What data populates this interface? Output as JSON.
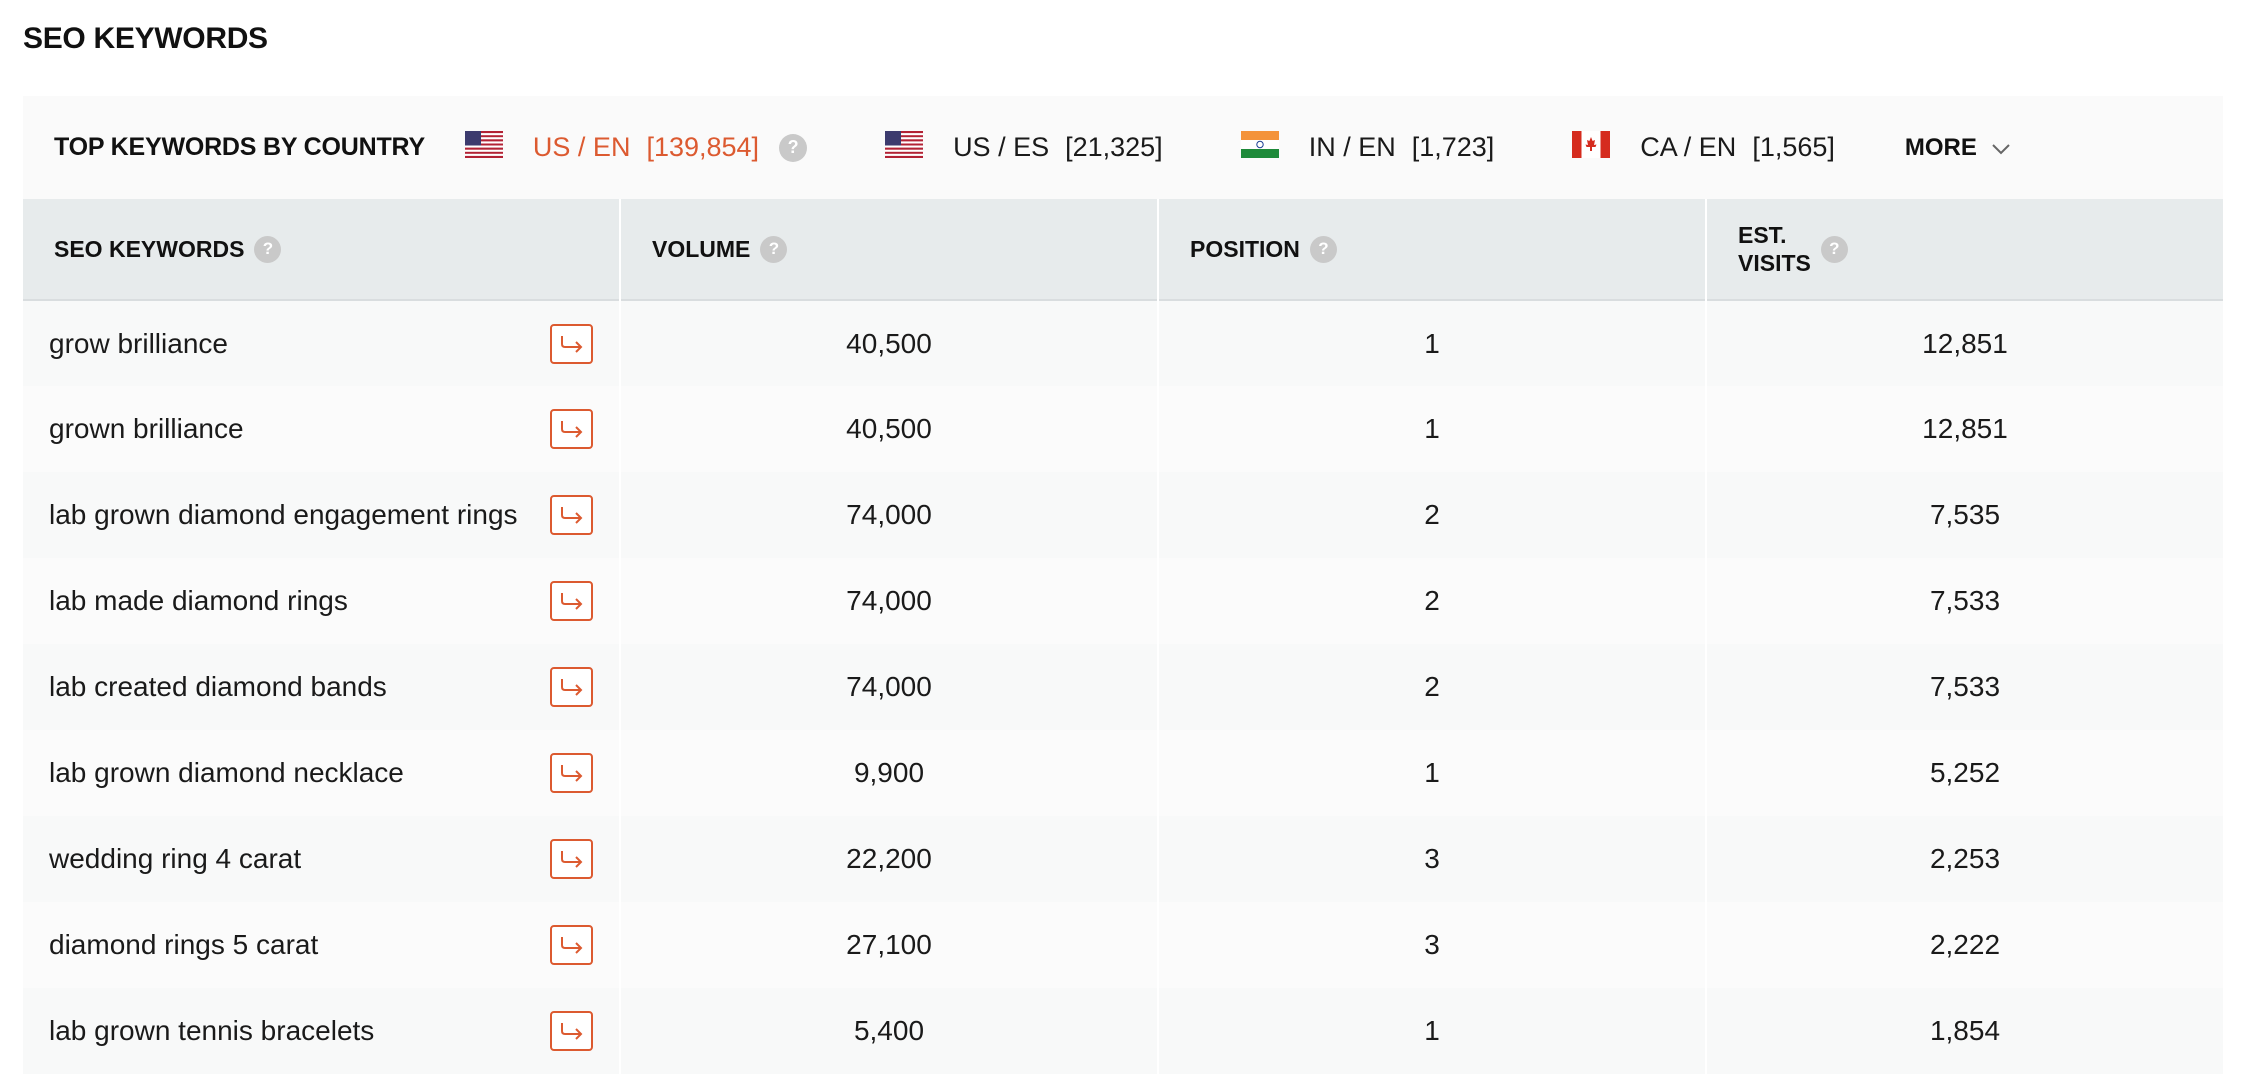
{
  "page": {
    "title": "SEO KEYWORDS"
  },
  "country_bar": {
    "label": "TOP KEYWORDS BY COUNTRY",
    "tabs": [
      {
        "code": "US / EN",
        "count": "[139,854]",
        "flag": "us-flag-icon",
        "active": true
      },
      {
        "code": "US / ES",
        "count": "[21,325]",
        "flag": "us-flag-icon",
        "active": false
      },
      {
        "code": "IN / EN",
        "count": "[1,723]",
        "flag": "india-flag-icon",
        "active": false
      },
      {
        "code": "CA / EN",
        "count": "[1,565]",
        "flag": "canada-flag-icon",
        "active": false
      }
    ],
    "more_label": "MORE",
    "help_glyph": "?"
  },
  "table": {
    "columns": [
      {
        "label": "SEO KEYWORDS"
      },
      {
        "label": "VOLUME"
      },
      {
        "label": "POSITION"
      },
      {
        "label": "EST.\nVISITS"
      }
    ],
    "rows": [
      {
        "keyword": "grow brilliance",
        "volume": "40,500",
        "position": "1",
        "visits": "12,851"
      },
      {
        "keyword": "grown brilliance",
        "volume": "40,500",
        "position": "1",
        "visits": "12,851"
      },
      {
        "keyword": "lab grown diamond engagement rings",
        "volume": "74,000",
        "position": "2",
        "visits": "7,535"
      },
      {
        "keyword": "lab made diamond rings",
        "volume": "74,000",
        "position": "2",
        "visits": "7,533"
      },
      {
        "keyword": "lab created diamond bands",
        "volume": "74,000",
        "position": "2",
        "visits": "7,533"
      },
      {
        "keyword": "lab grown diamond necklace",
        "volume": "9,900",
        "position": "1",
        "visits": "5,252"
      },
      {
        "keyword": "wedding ring 4 carat",
        "volume": "22,200",
        "position": "3",
        "visits": "2,253"
      },
      {
        "keyword": "diamond rings 5 carat",
        "volume": "27,100",
        "position": "3",
        "visits": "2,222"
      },
      {
        "keyword": "lab grown tennis bracelets",
        "volume": "5,400",
        "position": "1",
        "visits": "1,854"
      }
    ]
  },
  "colors": {
    "accent": "#dc5a30",
    "header_bg": "#e7ebec",
    "bar_bg": "#fafafa",
    "help_icon": "#c9c9c9"
  }
}
